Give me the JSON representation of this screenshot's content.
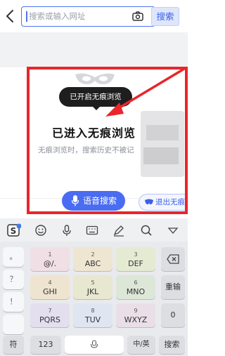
{
  "topbar": {
    "search_placeholder": "搜索或输入网址",
    "search_button": "搜索"
  },
  "incognito": {
    "tooltip": "已开启无痕浏览",
    "title": "已进入无痕浏览",
    "description": "无痕浏览时，搜索历史不被记",
    "voice_search": "语音搜索",
    "exit": "退出无痕"
  },
  "keyboard": {
    "left_column": [
      "。",
      "？",
      "！"
    ],
    "keys": [
      {
        "num": "1",
        "letters": "@/."
      },
      {
        "num": "2",
        "letters": "ABC"
      },
      {
        "num": "3",
        "letters": "DEF"
      },
      {
        "num": "4",
        "letters": "GHI"
      },
      {
        "num": "5",
        "letters": "JKL"
      },
      {
        "num": "6",
        "letters": "MNO"
      },
      {
        "num": "7",
        "letters": "PQRS"
      },
      {
        "num": "8",
        "letters": "TUV"
      },
      {
        "num": "9",
        "letters": "WXYZ"
      }
    ],
    "retype": "重输",
    "zero": "0",
    "symbol": "符",
    "num_mode": "123",
    "lang": "中/英",
    "enter": "搜索"
  },
  "colors": {
    "accent": "#4a6cf2",
    "annotation": "#e8262b"
  }
}
